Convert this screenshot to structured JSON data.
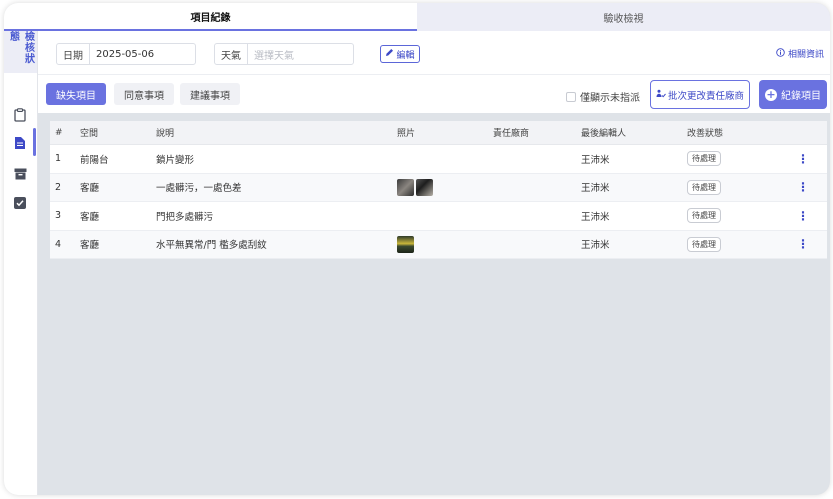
{
  "tabs": [
    "項目紀錄",
    "驗收檢視"
  ],
  "sidebar": {
    "title": "檢核狀態"
  },
  "filters": {
    "date_label": "日期",
    "date_value": "2025-05-06",
    "weather_label": "天氣",
    "weather_placeholder": "選擇天氣",
    "edit_label": "編輯",
    "related_label": "相關資訊"
  },
  "subtabs": [
    "缺失項目",
    "同意事項",
    "建議事項"
  ],
  "actions": {
    "only_unassigned": "僅顯示未指派",
    "batch_change": "批次更改責任廠商",
    "add_item": "紀錄項目"
  },
  "table": {
    "headers": [
      "#",
      "空間",
      "說明",
      "照片",
      "責任廠商",
      "最後編輯人",
      "改善狀態"
    ],
    "rows": [
      {
        "num": "1",
        "space": "前陽台",
        "desc": "鎖片變形",
        "photos": [],
        "vendor": "",
        "editor": "王沛米",
        "status": "待處理"
      },
      {
        "num": "2",
        "space": "客廳",
        "desc": "一處髒污，一處色差",
        "photos": [
          "photo-gray-dark",
          "photo-gray-mid"
        ],
        "vendor": "",
        "editor": "王沛米",
        "status": "待處理"
      },
      {
        "num": "3",
        "space": "客廳",
        "desc": "門把多處髒污",
        "photos": [],
        "vendor": "",
        "editor": "王沛米",
        "status": "待處理"
      },
      {
        "num": "4",
        "space": "客廳",
        "desc": "水平無異常/門 檻多處刮紋",
        "photos": [
          "photo-green-yellow"
        ],
        "vendor": "",
        "editor": "王沛米",
        "status": "待處理"
      }
    ]
  },
  "colors": {
    "accent": "#6a72e0",
    "accent_text": "#3d49c7"
  }
}
